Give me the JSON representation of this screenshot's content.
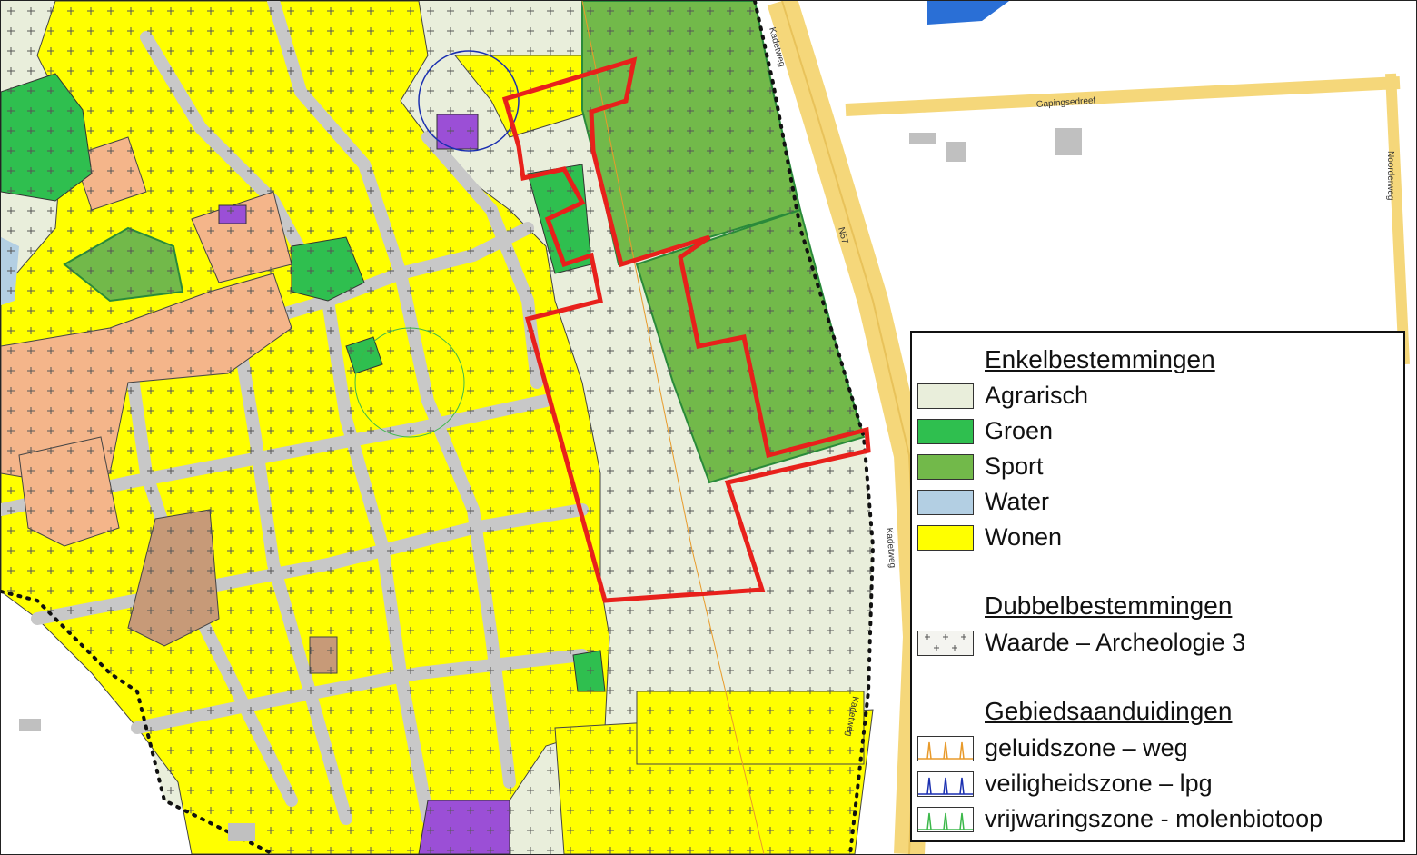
{
  "map": {
    "colors": {
      "agrarisch": "#e9eedb",
      "groen": "#2fbf4f",
      "sport": "#72b94a",
      "water": "#b3cfe3",
      "wonen": "#ffff00",
      "road": "#c8c8c8",
      "highway": "#f5d77a",
      "plan_boundary": "#e8201b",
      "centrum": "#f4b58a",
      "bedrijf": "#9b4fd6",
      "maatschappelijk": "#c79a78"
    },
    "road_labels": {
      "gapingsedreef": "Gapingsedreef",
      "kadetweg_top": "Kadetweg",
      "kadetweg_mid": "Kadetweg",
      "kadetweg_bottom": "Kadetweg",
      "noorderweg": "Noorderweg",
      "n57": "N57"
    }
  },
  "legend": {
    "enkel_heading": "Enkelbestemmingen",
    "enkel_items": [
      {
        "label": "Agrarisch",
        "color": "#e9eedb"
      },
      {
        "label": "Groen",
        "color": "#2fbf4f"
      },
      {
        "label": "Sport",
        "color": "#72b94a"
      },
      {
        "label": "Water",
        "color": "#b3cfe3"
      },
      {
        "label": "Wonen",
        "color": "#ffff00"
      }
    ],
    "dubbel_heading": "Dubbelbestemmingen",
    "dubbel_items": [
      {
        "label": "Waarde – Archeologie 3",
        "pattern": "crosses"
      }
    ],
    "gebied_heading": "Gebiedsaanduidingen",
    "gebied_items": [
      {
        "label": "geluidszone – weg",
        "color": "#e89a2a"
      },
      {
        "label": "veiligheidszone – lpg",
        "color": "#1a2fb0"
      },
      {
        "label": "vrijwaringszone - molenbiotoop",
        "color": "#3cb84a"
      }
    ]
  }
}
